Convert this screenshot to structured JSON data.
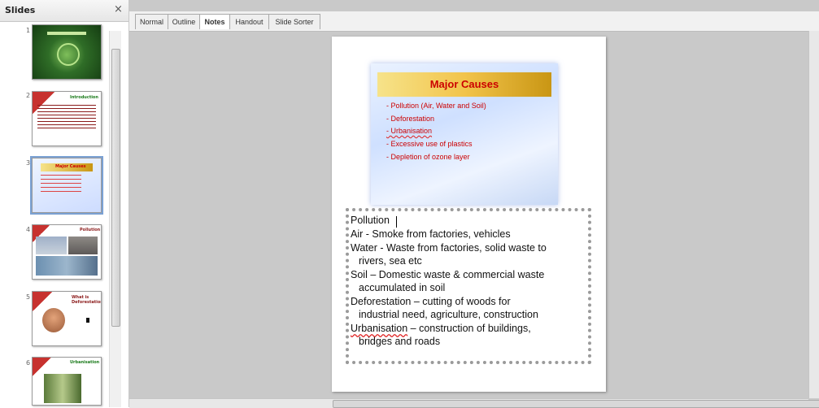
{
  "slides_panel": {
    "title": "Slides",
    "close_glyph": "×",
    "slides": [
      {
        "number": "1",
        "heading": ""
      },
      {
        "number": "2",
        "heading": "Introduction"
      },
      {
        "number": "3",
        "heading": "Major Causes"
      },
      {
        "number": "4",
        "heading": "Pollution"
      },
      {
        "number": "5",
        "heading": "What is Deforestation?"
      },
      {
        "number": "6",
        "heading": "Urbanisation"
      }
    ]
  },
  "tabs": [
    {
      "label": "Normal",
      "active": false
    },
    {
      "label": "Outline",
      "active": false
    },
    {
      "label": "Notes",
      "active": true
    },
    {
      "label": "Handout",
      "active": false
    },
    {
      "label": "Slide Sorter",
      "active": false
    }
  ],
  "slide": {
    "title": "Major Causes",
    "bullets": [
      "- Pollution (Air, Water and Soil)",
      "- Deforestation",
      "- Urbanisation",
      "- Excessive use of plastics",
      "- Depletion of ozone layer"
    ]
  },
  "notes": {
    "lines": [
      "Pollution",
      "Air - Smoke from factories, vehicles",
      "Water - Waste from factories, solid waste to",
      "rivers, sea etc",
      "Soil – Domestic waste & commercial waste",
      "accumulated in soil",
      "Deforestation – cutting of woods for",
      "industrial need, agriculture, construction",
      "Urbanisation",
      " – construction of buildings,",
      "bridges and roads"
    ]
  },
  "colors": {
    "accent_red": "#cc0000",
    "title_gold": "#f2c44b"
  }
}
